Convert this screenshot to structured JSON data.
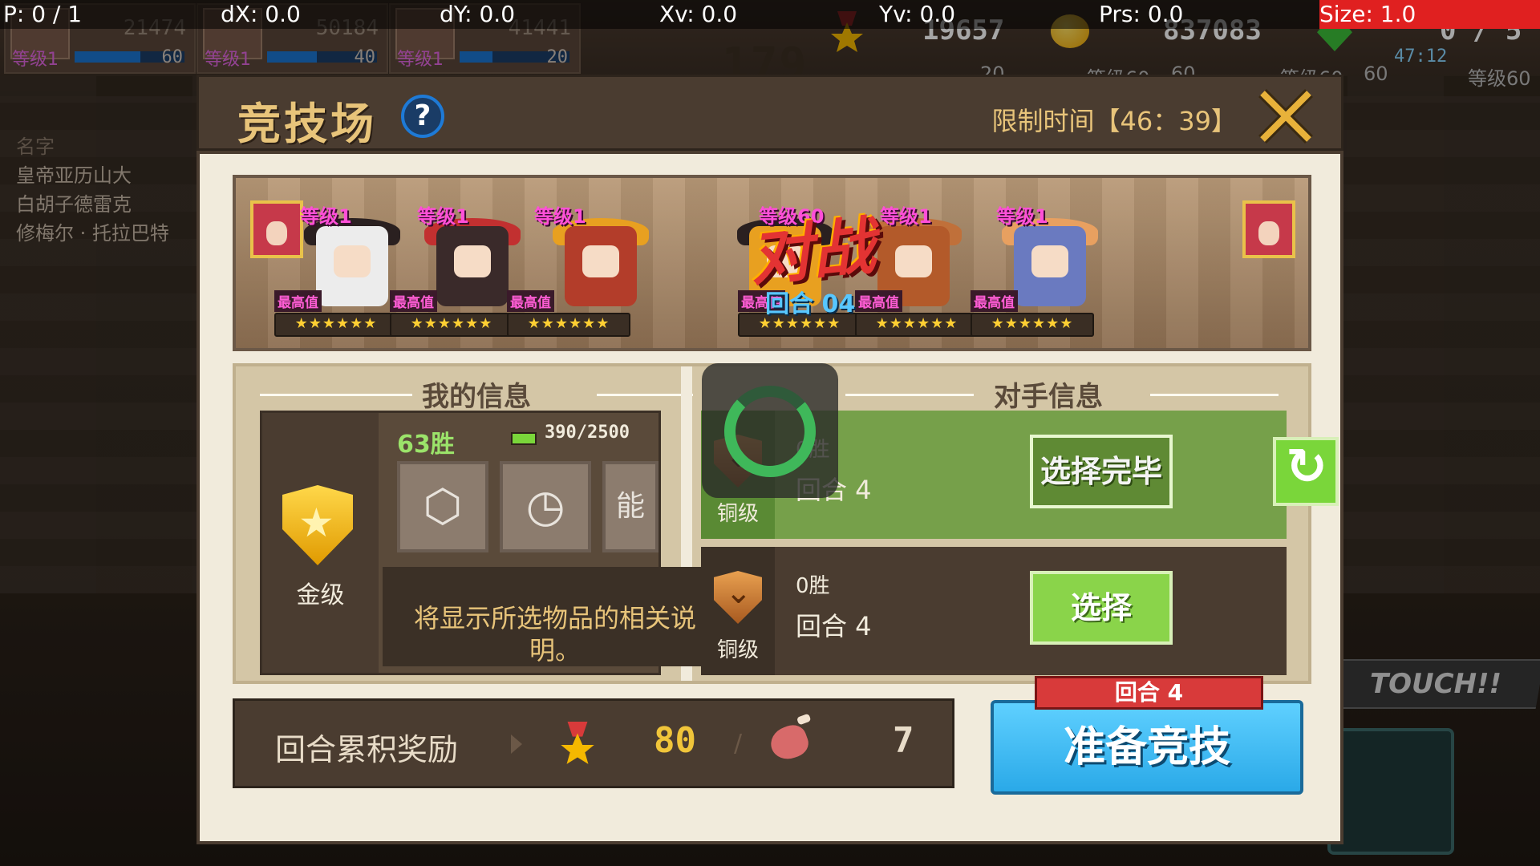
{
  "debug": {
    "pointer": "P: 0 / 1",
    "dx": "dX: 0.0",
    "dy": "dY: 0.0",
    "xv": "Xv: 0.0",
    "yv": "Yv: 0.0",
    "prs": "Prs: 0.0",
    "size": "Size: 1.0"
  },
  "hud": {
    "party": [
      {
        "power": "21474",
        "level": "等级1",
        "num": "60"
      },
      {
        "power": "50184",
        "level": "等级1",
        "num": "40"
      },
      {
        "power": "41441",
        "level": "等级1",
        "num": "20"
      }
    ],
    "big_number": "179",
    "medals": "19657",
    "coins": "837083",
    "gems": "0 / 5",
    "gem_timer": "47:12",
    "levels_right": [
      "20",
      "等级60",
      "60",
      "等级60",
      "60",
      "等级60"
    ]
  },
  "ranking": {
    "header": "名字",
    "names": [
      "皇帝亚历山大",
      "白胡子德雷克",
      "修梅尔 · 托拉巴特"
    ]
  },
  "side": {
    "touch": "TOUCH!!"
  },
  "modal": {
    "title": "竞技场",
    "help": "?",
    "limit_time": "限制时间【46：39】",
    "battle": {
      "vs": "对战",
      "round": "回合 04",
      "max_label": "最高值",
      "stars": "★★★★★★",
      "left_levels": [
        "等级1",
        "等级1",
        "等级1"
      ],
      "right_levels": [
        "等级60",
        "等级1",
        "等级1"
      ]
    },
    "my_info": {
      "title": "我的信息",
      "tier": "金级",
      "wins": "63胜",
      "xp_text": "390/2500",
      "xp": 390,
      "xp_max": 2500,
      "slot_cube_glyph": "⬡",
      "slot_timer_glyph": "◷",
      "slot_ability_glyph": "能",
      "description": "将显示所选物品的相关说明。"
    },
    "opponent_info": {
      "title": "对手信息",
      "opponents": [
        {
          "tier": "铜级",
          "wins": "0胜",
          "round": "回合 4",
          "button": "选择完毕"
        },
        {
          "tier": "铜级",
          "wins": "0胜",
          "round": "回合 4",
          "button": "选择"
        }
      ]
    },
    "reward": {
      "label": "回合累积奖励",
      "medals": "80",
      "separator": "/",
      "meat": "7"
    },
    "ready": {
      "ribbon": "回合 4",
      "label": "准备竞技"
    }
  },
  "colors": {
    "accent_gold": "#e8c47a",
    "level_pink": "#ff4fd8",
    "ready_blue": "#2aa9e8",
    "select_green": "#8ad44a"
  }
}
